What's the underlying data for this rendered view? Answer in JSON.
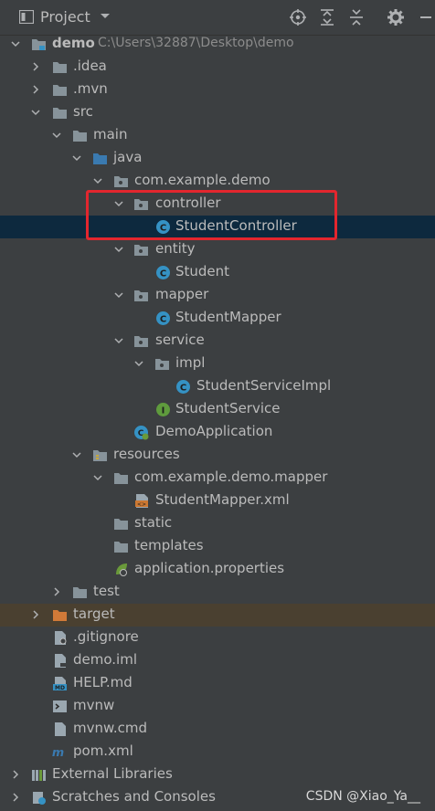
{
  "header": {
    "title": "Project"
  },
  "tree": {
    "root": {
      "name": "demo",
      "path": "C:\\Users\\32887\\Desktop\\demo"
    },
    "idea": ".idea",
    "mvn": ".mvn",
    "src": "src",
    "main": "main",
    "java": "java",
    "package": "com.example.demo",
    "controller": "controller",
    "student_controller": "StudentController",
    "entity": "entity",
    "student": "Student",
    "mapper": "mapper",
    "student_mapper": "StudentMapper",
    "service": "service",
    "impl": "impl",
    "student_service_impl": "StudentServiceImpl",
    "student_service": "StudentService",
    "demo_application": "DemoApplication",
    "resources": "resources",
    "mapper_package": "com.example.demo.mapper",
    "student_mapper_xml": "StudentMapper.xml",
    "static": "static",
    "templates": "templates",
    "application_properties": "application.properties",
    "test": "test",
    "target": "target",
    "gitignore": ".gitignore",
    "demo_iml": "demo.iml",
    "help_md": "HELP.md",
    "mvnw": "mvnw",
    "mvnw_cmd": "mvnw.cmd",
    "pom_xml": "pom.xml",
    "external_libraries": "External Libraries",
    "scratches": "Scratches and Consoles"
  },
  "watermark": "CSDN @Xiao_Ya__",
  "colors": {
    "background": "#3c3f41",
    "selected_row": "#0d293e",
    "excluded_row": "#4a4030",
    "highlight_border": "#e3262e",
    "folder": "#87939a",
    "class_icon": "#3592c4",
    "interface_icon": "#5f9b3d"
  }
}
